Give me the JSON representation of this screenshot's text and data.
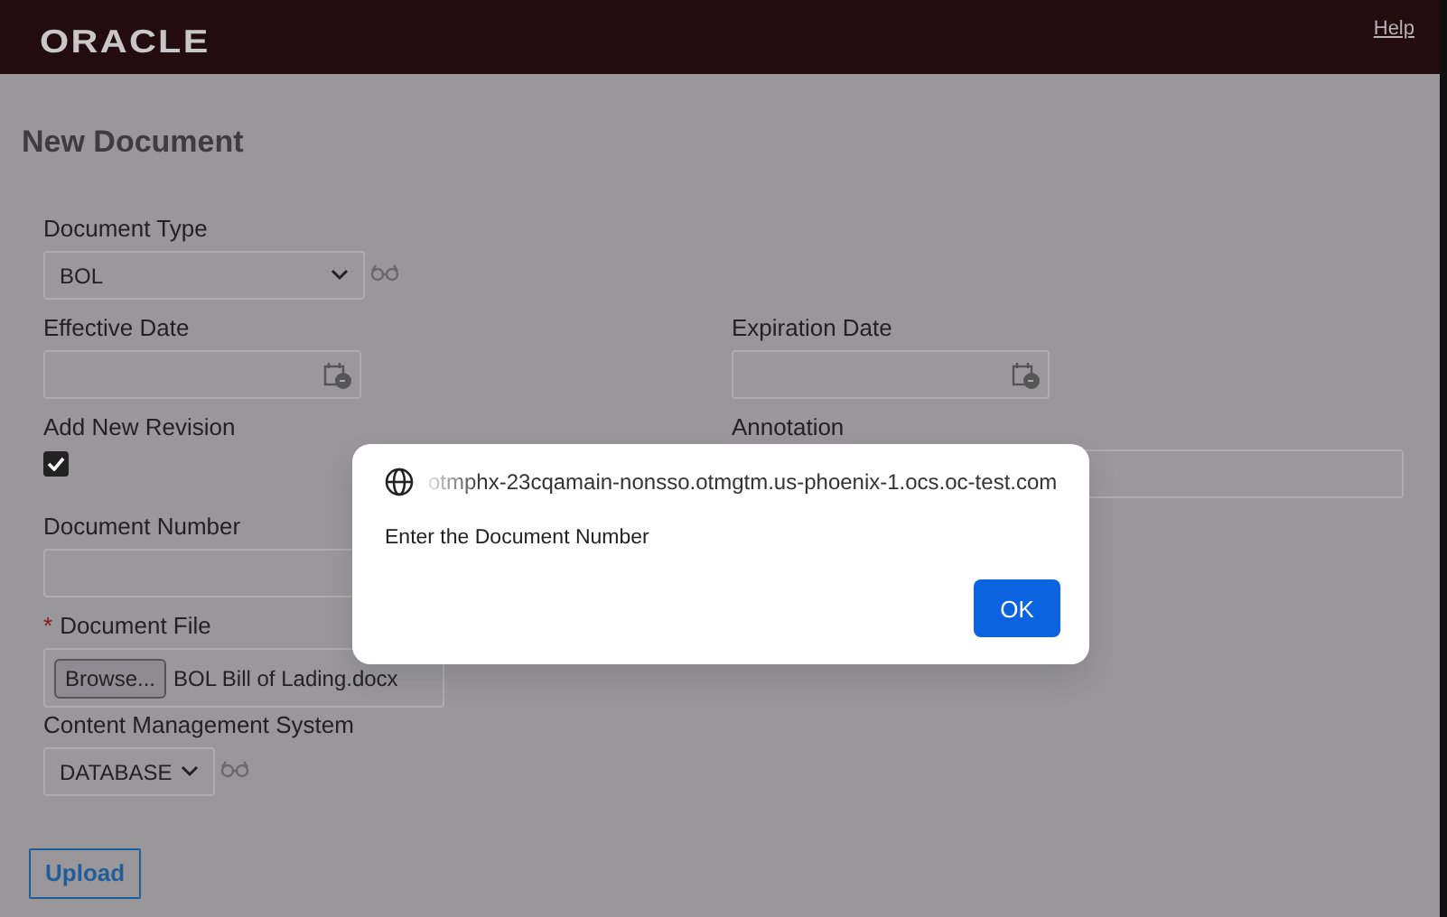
{
  "header": {
    "logo": "ORACLE",
    "help_link": "Help"
  },
  "page": {
    "title": "New Document"
  },
  "form": {
    "left_column": [
      {
        "kind": "select",
        "label": "Document Type",
        "value": "BOL",
        "lookup": true
      },
      {
        "kind": "date",
        "label": "Effective Date"
      },
      {
        "kind": "checkbox",
        "label": "Add New Revision",
        "checked": true
      },
      {
        "kind": "text",
        "label": "Document Number"
      },
      {
        "kind": "file",
        "label": "Document File",
        "required_mark": "*",
        "browse": "Browse...",
        "file_name": "BOL Bill of Lading.docx"
      },
      {
        "kind": "select",
        "label": "Content Management System",
        "value": "DATABASE",
        "lookup": true
      }
    ],
    "right_column": [
      {
        "kind": "date",
        "label": "Expiration Date"
      },
      {
        "kind": "text",
        "label": "Annotation"
      }
    ],
    "upload_button": "Upload"
  },
  "dialog": {
    "origin": "otmphx-23cqamain-nonsso.otmgtm.us-phoenix-1.ocs.oc-test.com",
    "message": "Enter the Document Number",
    "ok_button": "OK"
  }
}
